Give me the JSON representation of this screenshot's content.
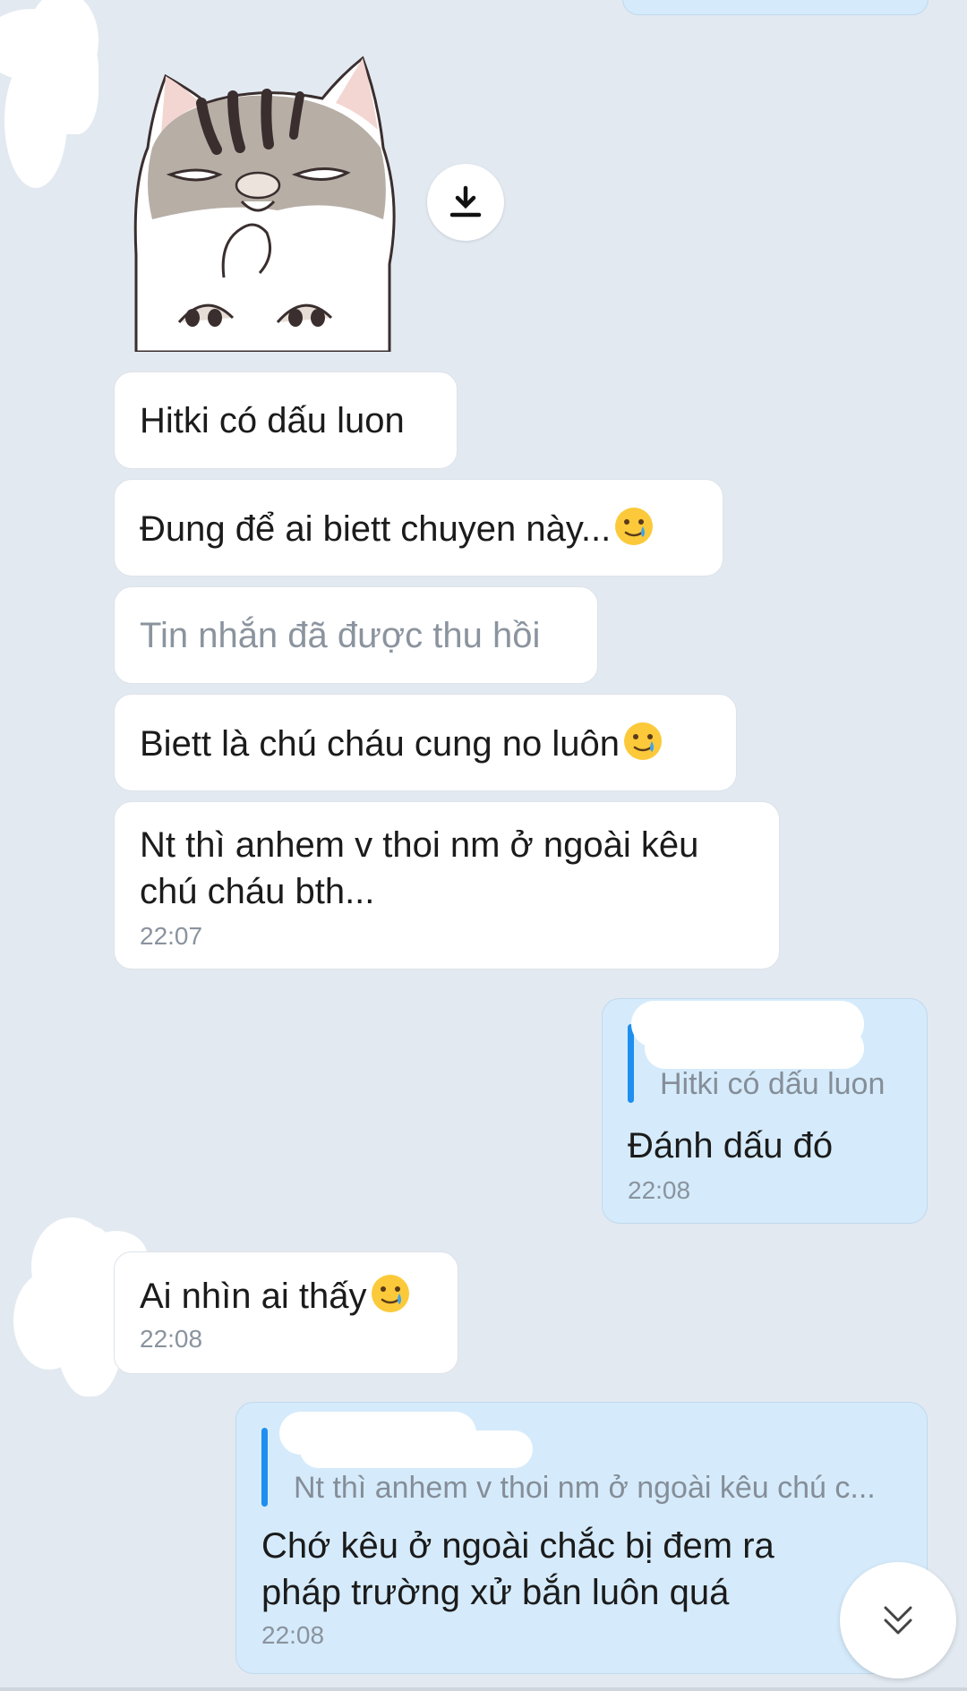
{
  "colors": {
    "chat_background": "#e2e9f1",
    "incoming_bubble": "#ffffff",
    "outgoing_bubble": "#d5ebfb",
    "quote_bar": "#1e8ef0",
    "timestamp": "#8a939e",
    "recalled_text": "#8b949e"
  },
  "sticker": {
    "icon": "sticker-cat",
    "download_icon": "download-icon"
  },
  "messages": {
    "m1": {
      "text": "Hitki có dấu luon"
    },
    "m2": {
      "text": "Đung để ai biett chuyen này...",
      "emoji": "smiling-face-with-tear"
    },
    "m3": {
      "text": "Tin nhắn đã được thu hồi"
    },
    "m4": {
      "text": "Biett là chú cháu cung no luôn",
      "emoji": "smiling-face-with-tear"
    },
    "m5": {
      "line1": "Nt thì anhem v thoi nm ở ngoài kêu",
      "line2": "chú cháu bth...",
      "time": "22:07"
    },
    "out1": {
      "quote": "Hitki có dấu luon",
      "text": "Đánh dấu đó",
      "time": "22:08"
    },
    "m6": {
      "text": "Ai nhìn ai thấy",
      "emoji": "smiling-face-with-tear",
      "time": "22:08"
    },
    "out2": {
      "quote": "Nt thì anhem v thoi nm ở ngoài kêu chú c...",
      "line1": "Chớ kêu ở ngoài chắc bị đem ra",
      "line2": "pháp trường xử bắn luôn quá",
      "time": "22:08"
    }
  },
  "scroll_button": {
    "icon": "double-chevron-down-icon"
  }
}
